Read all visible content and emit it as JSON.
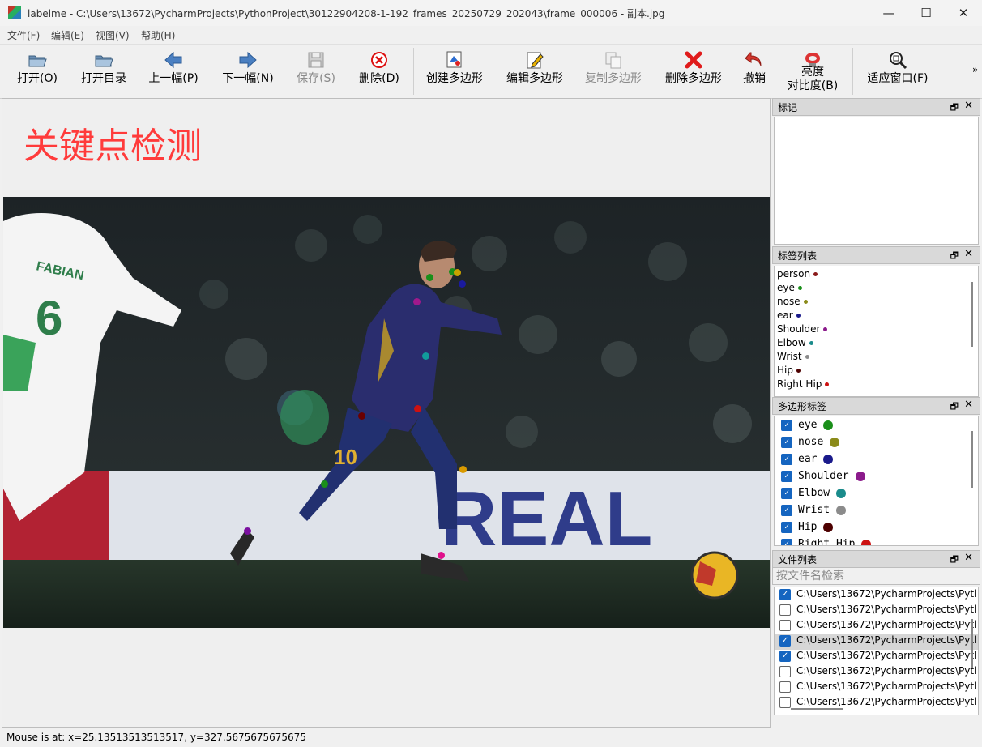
{
  "window": {
    "title": "labelme - C:\\Users\\13672\\PycharmProjects\\PythonProject\\30122904208-1-192_frames_20250729_202043\\frame_000006 - 副本.jpg",
    "minimize": "—",
    "maximize": "☐",
    "close": "✕"
  },
  "menu": [
    "文件(F)",
    "编辑(E)",
    "视图(V)",
    "帮助(H)"
  ],
  "toolbar": {
    "open": "打开(O)",
    "open_dir": "打开目录",
    "prev": "上一幅(P)",
    "next": "下一幅(N)",
    "save": "保存(S)",
    "delete": "删除(D)",
    "create_poly": "创建多边形",
    "edit_poly": "编辑多边形",
    "copy_poly": "复制多边形",
    "delete_poly": "删除多边形",
    "undo": "撤销",
    "brightness_line1": "亮度",
    "brightness_line2": "对比度(B)",
    "fit_window": "适应窗口(F)",
    "more": "»"
  },
  "canvas": {
    "heading": "关键点检测",
    "jersey_name": "FABIAN",
    "jersey_number_left": "6",
    "jersey_number_right": "10",
    "banner_text": "REAL",
    "keypoints": [
      {
        "name": "eye",
        "color": "#1a8f1a"
      },
      {
        "name": "eye",
        "color": "#1a8f1a"
      },
      {
        "name": "nose",
        "color": "#c8a200"
      },
      {
        "name": "ear",
        "color": "#1a1a9f"
      },
      {
        "name": "shoulder",
        "color": "#a0198c"
      },
      {
        "name": "elbow",
        "color": "#119b9b"
      },
      {
        "name": "hip",
        "color": "#cc1111"
      },
      {
        "name": "hip",
        "color": "#6b0000"
      },
      {
        "name": "knee",
        "color": "#d99a00"
      },
      {
        "name": "knee",
        "color": "#1a8f1a"
      },
      {
        "name": "ankle",
        "color": "#7a0f9f"
      },
      {
        "name": "ankle",
        "color": "#e0118c"
      }
    ]
  },
  "docks": {
    "flags": {
      "title": "标记",
      "float": "🗗",
      "close": "✕"
    },
    "label_list": {
      "title": "标签列表",
      "float": "🗗",
      "close": "✕",
      "items": [
        {
          "label": "person",
          "color": "#8b1a1a"
        },
        {
          "label": "eye",
          "color": "#1a8f1a"
        },
        {
          "label": "nose",
          "color": "#8b8b1a"
        },
        {
          "label": "ear",
          "color": "#1a1a8b"
        },
        {
          "label": "Shoulder",
          "color": "#8b1a8b"
        },
        {
          "label": "Elbow",
          "color": "#1a8b8b"
        },
        {
          "label": "Wrist",
          "color": "#8b8b8b"
        },
        {
          "label": "Hip",
          "color": "#4d0000"
        },
        {
          "label": "Right Hip",
          "color": "#cc1111"
        }
      ]
    },
    "polygon_labels": {
      "title": "多边形标签",
      "float": "🗗",
      "close": "✕",
      "items": [
        {
          "label": "eye",
          "color": "#1a8f1a"
        },
        {
          "label": "nose",
          "color": "#8b8b1a"
        },
        {
          "label": "ear",
          "color": "#1a1a8b"
        },
        {
          "label": "Shoulder",
          "color": "#8b1a8b"
        },
        {
          "label": "Elbow",
          "color": "#1a8b8b"
        },
        {
          "label": "Wrist",
          "color": "#8b8b8b"
        },
        {
          "label": "Hip",
          "color": "#4d0000"
        },
        {
          "label": "Right Hip",
          "color": "#cc1111"
        }
      ]
    },
    "file_list": {
      "title": "文件列表",
      "float": "🗗",
      "close": "✕",
      "search_placeholder": "按文件名检索",
      "items": [
        {
          "path": "C:\\Users\\13672\\PycharmProjects\\Pytl",
          "checked": true,
          "selected": false
        },
        {
          "path": "C:\\Users\\13672\\PycharmProjects\\Pytl",
          "checked": false,
          "selected": false
        },
        {
          "path": "C:\\Users\\13672\\PycharmProjects\\Pytl",
          "checked": false,
          "selected": false
        },
        {
          "path": "C:\\Users\\13672\\PycharmProjects\\Pytl",
          "checked": true,
          "selected": true
        },
        {
          "path": "C:\\Users\\13672\\PycharmProjects\\Pytl",
          "checked": true,
          "selected": false
        },
        {
          "path": "C:\\Users\\13672\\PycharmProjects\\Pytl",
          "checked": false,
          "selected": false
        },
        {
          "path": "C:\\Users\\13672\\PycharmProjects\\Pytl",
          "checked": false,
          "selected": false
        },
        {
          "path": "C:\\Users\\13672\\PycharmProjects\\Pytl",
          "checked": false,
          "selected": false
        }
      ]
    }
  },
  "status": "Mouse is at: x=25.13513513513517, y=327.5675675675675"
}
